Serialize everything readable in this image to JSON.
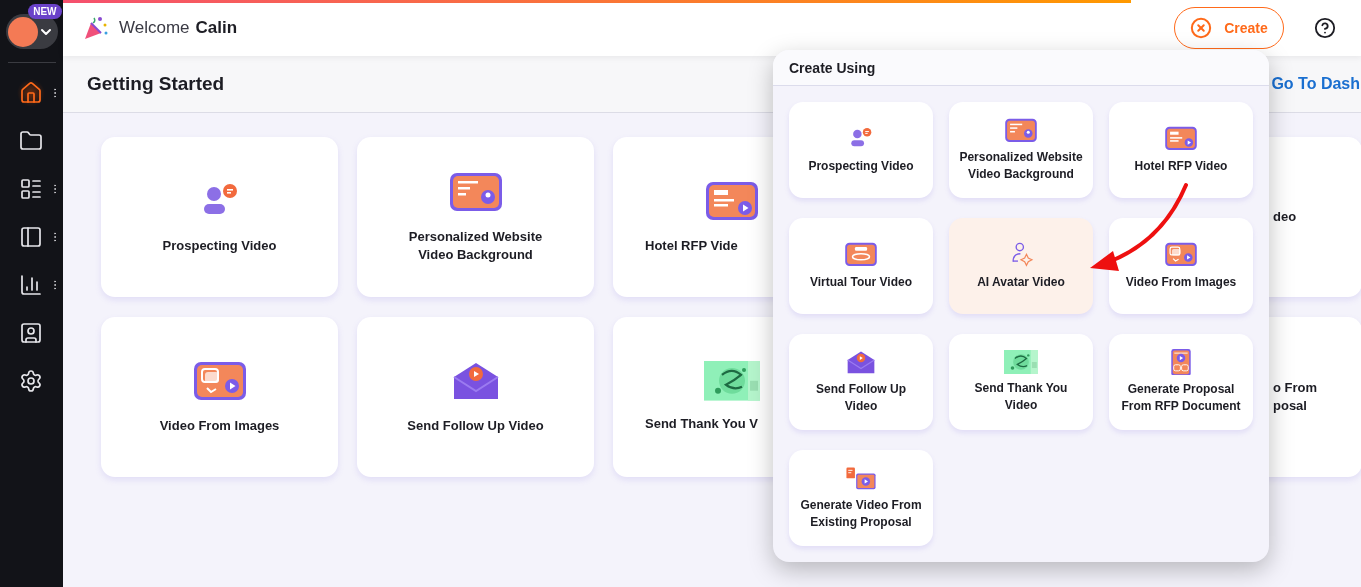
{
  "sidebar": {
    "badge": "NEW",
    "items": [
      {
        "kind": "home",
        "selected": true,
        "menu": true
      },
      {
        "kind": "folder",
        "selected": false,
        "menu": false
      },
      {
        "kind": "list",
        "selected": false,
        "menu": true
      },
      {
        "kind": "panel",
        "selected": false,
        "menu": true
      },
      {
        "kind": "chart",
        "selected": false,
        "menu": true
      },
      {
        "kind": "presenter",
        "selected": false,
        "menu": false
      },
      {
        "kind": "settings",
        "selected": false,
        "menu": false
      }
    ]
  },
  "header": {
    "greeting": "Welcome",
    "name": "Calin",
    "create_button": "Create"
  },
  "page": {
    "title": "Getting Started",
    "link": "Go To Dash"
  },
  "cards": [
    [
      {
        "kind": "prospect",
        "label": "Prospecting Video"
      },
      {
        "kind": "website",
        "label": "Personalized Website\nVideo Background"
      },
      {
        "kind": "rfp",
        "label": "Hotel RFP Vide"
      },
      {
        "kind": "none",
        "label": "deo"
      }
    ],
    [
      {
        "kind": "images",
        "label": "Video From Images"
      },
      {
        "kind": "mail",
        "label": "Send Follow Up Video"
      },
      {
        "kind": "thanks",
        "label": "Send Thank You V"
      },
      {
        "kind": "none",
        "label": "o From\nposal"
      }
    ]
  ],
  "create_menu": {
    "title": "Create Using",
    "items": [
      {
        "kind": "prospect",
        "label": "Prospecting Video",
        "selected": false
      },
      {
        "kind": "website",
        "label": "Personalized Website\nVideo Background",
        "selected": false
      },
      {
        "kind": "rfp",
        "label": "Hotel RFP Video",
        "selected": false
      },
      {
        "kind": "tour",
        "label": "Virtual Tour Video",
        "selected": false
      },
      {
        "kind": "avatar",
        "label": "AI Avatar Video",
        "selected": true
      },
      {
        "kind": "images",
        "label": "Video From Images",
        "selected": false
      },
      {
        "kind": "mail",
        "label": "Send Follow Up\nVideo",
        "selected": false
      },
      {
        "kind": "thanks",
        "label": "Send Thank You\nVideo",
        "selected": false
      },
      {
        "kind": "proposal",
        "label": "Generate Proposal\nFrom RFP Document",
        "selected": false
      },
      {
        "kind": "existing",
        "label": "Generate Video From\nExisting Proposal",
        "selected": false
      }
    ]
  }
}
